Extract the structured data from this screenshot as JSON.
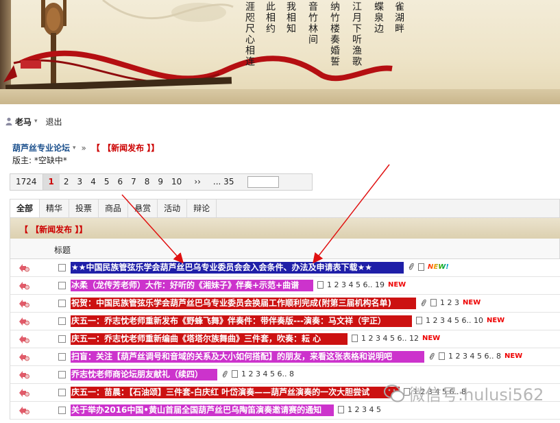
{
  "banner": {
    "poem_columns": [
      "雀湖畔",
      "蝶泉边",
      "江月下听渔歌",
      "纳竹楼奏婚誓",
      "音竹林间",
      "我相知",
      "此相约",
      "涯咫尺心相连"
    ]
  },
  "user": {
    "name": "老马",
    "logout": "退出"
  },
  "breadcrumb": {
    "forum": "葫芦丝专业论坛",
    "separator": "»",
    "category": "【 【新闻发布 】】"
  },
  "moderator": "版主: *空缺中*",
  "pager": {
    "total": "1724",
    "current": "1",
    "pages": [
      "2",
      "3",
      "4",
      "5",
      "6",
      "7",
      "8",
      "9",
      "10"
    ],
    "next": "››",
    "last": "... 35"
  },
  "tabs": [
    "全部",
    "精华",
    "投票",
    "商品",
    "悬赏",
    "活动",
    "辩论"
  ],
  "category_header": "【 【新闻发布 】】",
  "column_title": "标题",
  "threads": [
    {
      "subject": "★★中国民族管弦乐学会葫芦丝巴乌专业委员会会入会条件、办法及申请表下载★★",
      "bg": "#1f1fa8",
      "fg": "#ffffff",
      "width": 486,
      "clip": true,
      "doc": true,
      "pages": "",
      "new_label": "NEW!"
    },
    {
      "subject": "冰柔（龙传芳老师）大作：好听的《湘妹子》伴奏+示范+曲谱",
      "bg": "#cc33cc",
      "fg": "#ffffff",
      "width": 354,
      "clip": false,
      "doc": true,
      "pages": "1 2 3 4 5 6.. 19",
      "new_label": "NEW"
    },
    {
      "subject": "祝贺：中国民族管弦乐学会葫芦丝巴乌专业委员会换届工作顺利完成(附第三届机构名单)",
      "bg": "#cc1111",
      "fg": "#ffffff",
      "width": 504,
      "clip": true,
      "doc": true,
      "pages": "1 2 3",
      "new_label": "NEW"
    },
    {
      "subject": "庆五一：乔志忱老师重新发布《野蜂飞舞》伴奏件：带伴奏版---演奏：马文祥（宇正）",
      "bg": "#cc1111",
      "fg": "#ffffff",
      "width": 498,
      "clip": false,
      "doc": true,
      "pages": "1 2 3 4 5 6.. 10",
      "new_label": "NEW"
    },
    {
      "subject": "庆五一：乔志忱老师重新编曲《塔塔尔族舞曲》三件套，吹奏：耘 心",
      "bg": "#cc1111",
      "fg": "#ffffff",
      "width": 404,
      "clip": false,
      "doc": true,
      "pages": "1 2 3 4 5 6.. 12",
      "new_label": "NEW"
    },
    {
      "subject": "扫盲：关注【葫芦丝调号和音域的关系及大小如何搭配】的朋友，来看这张表格和说明吧",
      "bg": "#cc33cc",
      "fg": "#ffffff",
      "width": 516,
      "clip": true,
      "doc": true,
      "pages": "1 2 3 4 5 6.. 8",
      "new_label": "NEW"
    },
    {
      "subject": "乔志忱老师商论坛朋友献礼（续四）",
      "bg": "#cc33cc",
      "fg": "#ffffff",
      "width": 214,
      "clip": true,
      "doc": true,
      "pages": "1 2 3 4 5 6.. 8",
      "new_label": ""
    },
    {
      "subject": "庆五一：苗晨：【石油颂】三件套-白庆红 叶岱演奏——葫芦丝演奏的一次大胆尝试",
      "bg": "#cc1111",
      "fg": "#ffffff",
      "width": 480,
      "clip": false,
      "doc": true,
      "pages": "1 2 3 4 5 6.. 8",
      "new_label": ""
    },
    {
      "subject": "关于举办2016中国•黄山首届全国葫芦丝巴乌陶笛演奏邀请赛的通知",
      "bg": "#cc33cc",
      "fg": "#ffffff",
      "width": 384,
      "clip": false,
      "doc": true,
      "pages": "1 2 3 4 5",
      "new_label": ""
    }
  ],
  "watermark": "微信号:hulusi562",
  "colors": {
    "link_blue": "#1a4f8c",
    "accent_red": "#cc0000",
    "arrow_red": "#e01010",
    "new_red": "#ee0000"
  }
}
